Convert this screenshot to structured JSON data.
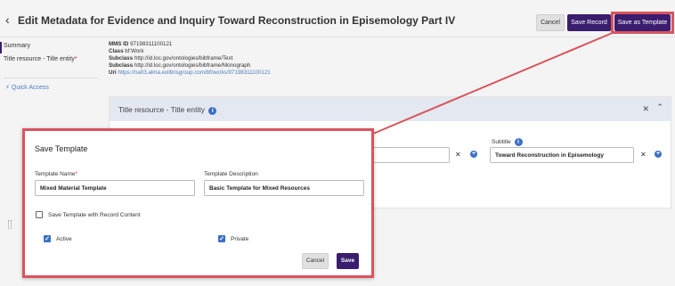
{
  "header": {
    "back_icon": "chevron-left-icon",
    "title": "Edit Metadata for Evidence and Inquiry Toward Reconstruction in Episemology Part IV",
    "cancel_label": "Cancel",
    "save_record_label": "Save Record",
    "save_template_label": "Save as Template",
    "accent_color": "#3a1d6e",
    "highlight_color": "#d9545c"
  },
  "sidebar": {
    "items": [
      {
        "label": "Summary"
      },
      {
        "label": "Title resource - Title entity",
        "required_mark": "*"
      }
    ],
    "quick_access": {
      "icon": "bolt-icon",
      "label": "Quick Access"
    }
  },
  "metadata": {
    "mms_id_label": "MMS ID",
    "mms_id_value": "97198311100121",
    "class_label": "Class",
    "class_value": "bf:Work",
    "subclass_label": "Subclass",
    "subclass_1": "http://id.loc.gov/ontologies/bibframe/Text",
    "subclass_2": "http://id.loc.gov/ontologies/bibframe/Monograph",
    "uri_label": "Uri",
    "uri_value": "https://na03.alma.exlibrisgroup.com/bf/works/97198311100121"
  },
  "panel": {
    "title": "Title resource - Title entity",
    "subtitle_label": "Subtitle",
    "subtitle_value": "Toward Reconstruction in Episemology"
  },
  "modal": {
    "title": "Save Template",
    "template_name_label": "Template Name",
    "template_name_required": "*",
    "template_name_value": "Mixed Material Template",
    "template_description_label": "Template Description",
    "template_description_value": "Basic Template for Mixed Resources",
    "save_with_content_label": "Save Template with Record Content",
    "save_with_content_checked": false,
    "active_label": "Active",
    "active_checked": true,
    "private_label": "Private",
    "private_checked": true,
    "cancel_label": "Cancel",
    "save_label": "Save"
  }
}
